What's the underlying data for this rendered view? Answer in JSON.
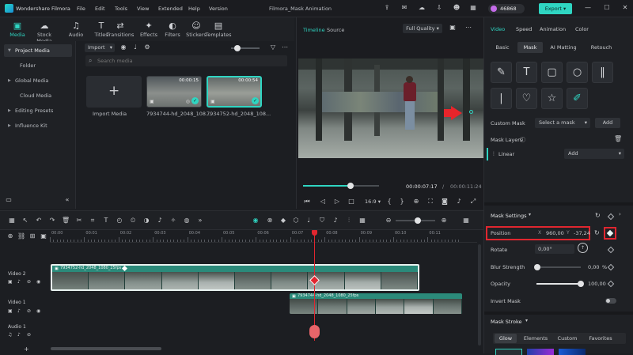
{
  "titlebar": {
    "app_name": "Wondershare Filmora",
    "menus": [
      "File",
      "Edit",
      "Tools",
      "View",
      "Extended",
      "Help",
      "Version"
    ],
    "project_title": "Filmora_Mask Animation",
    "credits": "46868",
    "export_label": "Export"
  },
  "ribbon": {
    "tabs": [
      {
        "label": "Media",
        "icon": "▣"
      },
      {
        "label": "Stock Media",
        "icon": "☁"
      },
      {
        "label": "Audio",
        "icon": "♫"
      },
      {
        "label": "Titles",
        "icon": "T"
      },
      {
        "label": "Transitions",
        "icon": "⇄"
      },
      {
        "label": "Effects",
        "icon": "✦"
      },
      {
        "label": "Filters",
        "icon": "◐"
      },
      {
        "label": "Stickers",
        "icon": "☺"
      },
      {
        "label": "Templates",
        "icon": "▤"
      }
    ]
  },
  "leftnav": {
    "items": [
      "Project Media",
      "Folder",
      "Global Media",
      "Cloud Media",
      "Editing Presets",
      "Influence Kit"
    ]
  },
  "media": {
    "import_label": "Import",
    "search_placeholder": "Search media",
    "import_media_label": "Import Media",
    "clips": [
      {
        "name": "7934744-hd_2048_108...",
        "duration": "00:00:15"
      },
      {
        "name": "7934752-hd_2048_108...",
        "duration": "00:00:54"
      }
    ]
  },
  "preview": {
    "tab_timeline": "Timeline",
    "tab_source": "Source",
    "quality": "Full Quality",
    "current_time": "00:00:07:17",
    "total_time": "00:00:11:24",
    "separator": "/",
    "ratio": "16:9",
    "progress": 0.62
  },
  "rpanel": {
    "tabs": [
      "Video",
      "Speed",
      "Animation",
      "Color"
    ],
    "subtabs": [
      "Basic",
      "Mask",
      "AI Matting",
      "Retouch"
    ],
    "custom_mask_label": "Custom Mask",
    "select_mask": "Select a mask",
    "add_label": "Add",
    "mask_layers_label": "Mask Layers",
    "layer_name": "Linear",
    "layer_add": "Add",
    "mask_settings_label": "Mask Settings",
    "position_label": "Position",
    "pos_x_axis": "X",
    "pos_x": "960,00",
    "pos_y_axis": "Y",
    "pos_y": "-37,24",
    "rotate_label": "Rotate",
    "rotate_value": "0,00°",
    "blur_label": "Blur Strength",
    "blur_value": "0,00",
    "blur_unit": "%",
    "opacity_label": "Opacity",
    "opacity_value": "100,00",
    "invert_label": "Invert Mask",
    "stroke_label": "Mask Stroke",
    "stroke_tabs": [
      "Glow",
      "Elements",
      "Custom",
      "Favorites"
    ],
    "accent": "#2fd5c2",
    "highlight": "#e0262f"
  },
  "timeline": {
    "ruler": [
      "00:00",
      "00:01",
      "00:02",
      "00:03",
      "00:04",
      "00:05",
      "00:06",
      "00:07",
      "00:08",
      "00:09",
      "00:10",
      "00:11"
    ],
    "tracks": [
      {
        "label": "Video 2"
      },
      {
        "label": "Video 1"
      },
      {
        "label": "Audio 1"
      }
    ],
    "clip_top": "7934752-hd_2048_1080_25fps",
    "clip_bottom": "7934744-hd_2048_1080_25fps"
  }
}
